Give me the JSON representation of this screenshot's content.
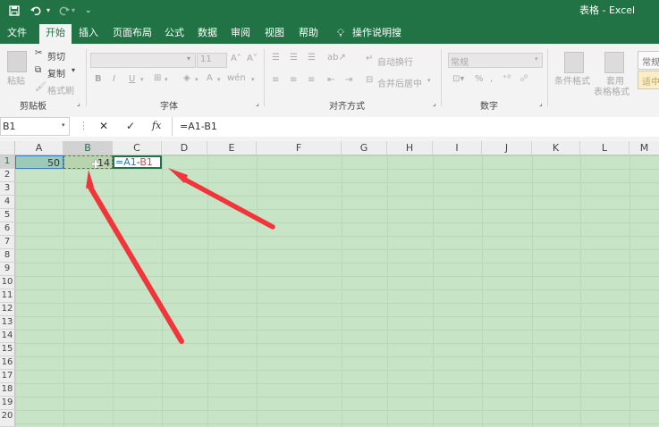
{
  "titlebar": {
    "title": "表格 - Excel",
    "qat": {
      "save_icon": "save-icon",
      "undo_icon": "undo-icon",
      "redo_icon": "redo-icon"
    }
  },
  "tabs": [
    {
      "label": "文件"
    },
    {
      "label": "开始"
    },
    {
      "label": "插入"
    },
    {
      "label": "页面布局"
    },
    {
      "label": "公式"
    },
    {
      "label": "数据"
    },
    {
      "label": "审阅"
    },
    {
      "label": "视图"
    },
    {
      "label": "帮助"
    },
    {
      "label": "操作说明搜索"
    }
  ],
  "ribbon": {
    "paste": "粘贴",
    "cut": "剪切",
    "copy": "复制",
    "format_painter": "格式刷",
    "clipboard": "剪贴板",
    "font_size": "11",
    "font_group": "字体",
    "wrap_text": "自动换行",
    "merge_center": "合并后居中",
    "alignment": "对齐方式",
    "number_format": "常规",
    "number_group": "数字",
    "conditional": "条件格式",
    "table_format_1": "套用",
    "table_format_2": "表格格式",
    "style_normal": "常规",
    "style_neutral": "适中",
    "bold": "B",
    "italic": "I",
    "underline": "U",
    "percent": "%"
  },
  "formula_bar": {
    "name_box": "B1",
    "cancel": "✕",
    "enter": "✓",
    "fx": "fx",
    "formula": "=A1-B1"
  },
  "columns": [
    "A",
    "B",
    "C",
    "D",
    "E",
    "F",
    "G",
    "H",
    "I",
    "J",
    "K",
    "L",
    "M"
  ],
  "rows": [
    "1",
    "2",
    "3",
    "4",
    "5",
    "6",
    "7",
    "8",
    "9",
    "10",
    "11",
    "12",
    "13",
    "14",
    "15",
    "16",
    "17",
    "18",
    "19",
    "20"
  ],
  "cells": {
    "A1": "50",
    "B1": "14",
    "C1_a": "=A1",
    "C1_op": "-",
    "C1_b": "B1"
  },
  "colors": {
    "excel_green": "#217346",
    "grid_bg": "#c8e4c7",
    "arrow": "#f0353b",
    "ref_blue": "#2e75b6",
    "ref_red": "#c0504d"
  }
}
